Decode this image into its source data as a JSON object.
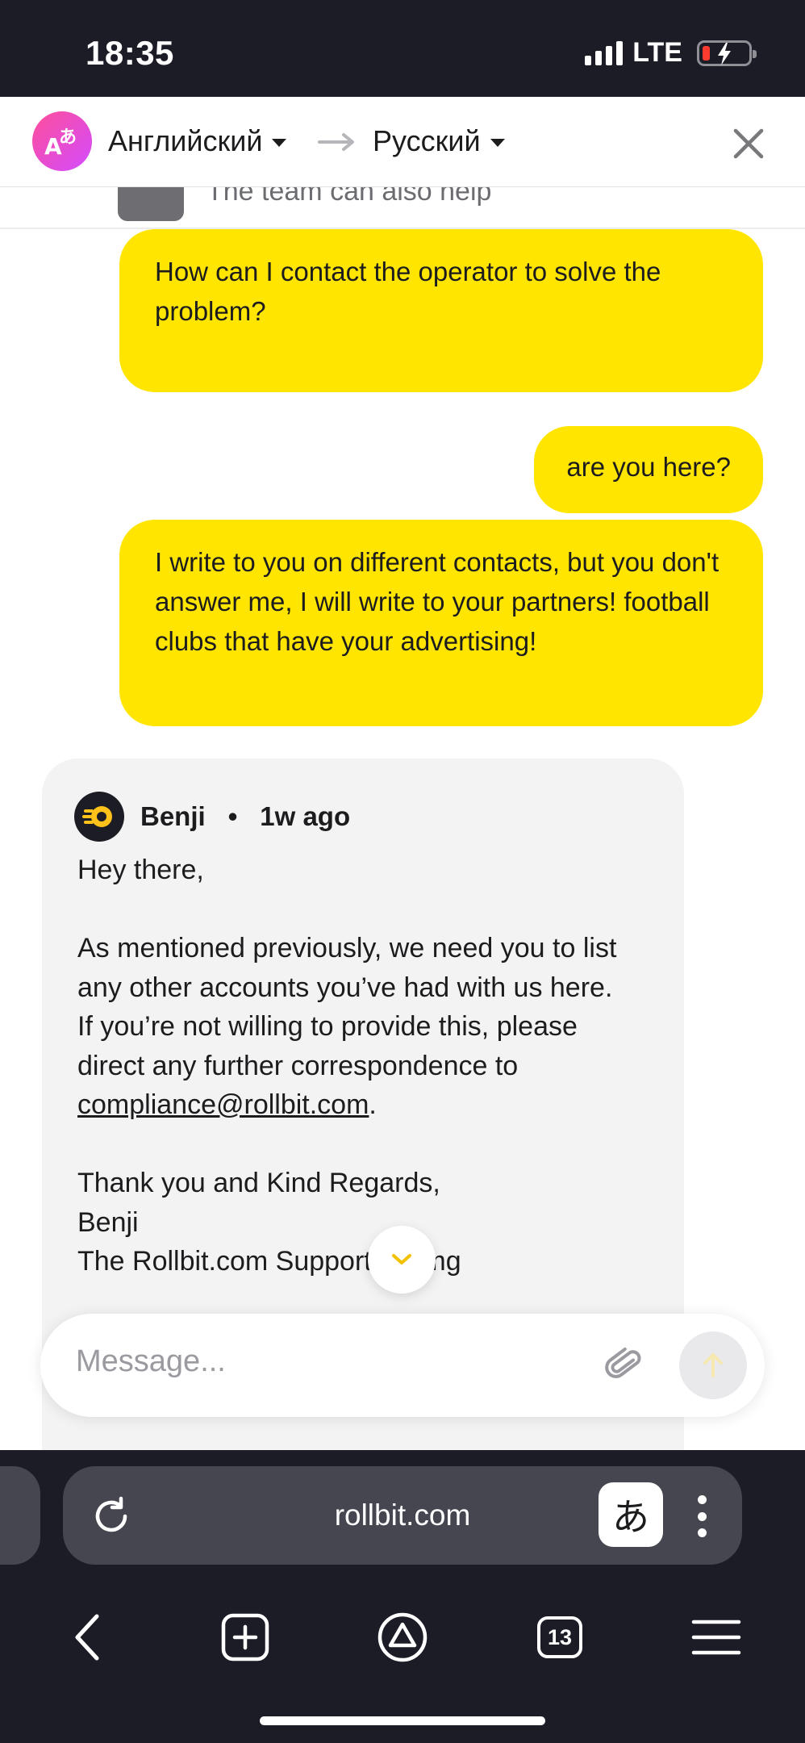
{
  "status_bar": {
    "time": "18:35",
    "network": "LTE",
    "icons": [
      "signal-icon",
      "battery-charging-icon"
    ]
  },
  "translator": {
    "logo_icon": "translate-icon",
    "from_language": "Английский",
    "to_language": "Русский",
    "icons": [
      "arrow-right-icon",
      "close-icon",
      "chevron-down-icon"
    ]
  },
  "chat": {
    "cut_off_text": "The team can also help",
    "outgoing_messages": [
      {
        "text": "How can I contact the operator to solve the problem?"
      },
      {
        "text": "are you here?"
      },
      {
        "text": "I write to you on different contacts, but you don't answer me, I will write to your partners! football clubs that have your advertising!"
      }
    ],
    "incoming_message": {
      "author": "Benji",
      "separator": "•",
      "time_ago": "1w ago",
      "greeting": "Hey there,",
      "para1": "As mentioned previously, we need you to list any other accounts you’ve had with us here.",
      "para2_before_link": "If you’re not willing to provide this, please direct any further correspondence to",
      "link": "compliance@rollbit.com",
      "para2_after_link": ".",
      "closing": "Thank you and Kind Regards,",
      "signature_name": "Benji",
      "signature_team": "The Rollbit.com Support Teamg"
    }
  },
  "composer": {
    "placeholder": "Message...",
    "icons": [
      "paperclip-icon",
      "send-arrow-icon",
      "scroll-down-chevron-icon"
    ]
  },
  "browser": {
    "url": "rollbit.com",
    "translate_glyph": "あ",
    "tabs_count": "13",
    "icons": [
      "reload-icon",
      "kebab-menu-icon",
      "back-icon",
      "new-tab-icon",
      "alice-assistant-icon",
      "hamburger-menu-icon"
    ]
  },
  "colors": {
    "outgoing_bubble": "#ffe500",
    "incoming_bubble": "#f3f3f4",
    "status_bar_bg": "#1b1c26",
    "browser_bar_bg": "#1b1c26",
    "translator_logo_gradient": [
      "#ff4f9a",
      "#d24bff"
    ]
  }
}
